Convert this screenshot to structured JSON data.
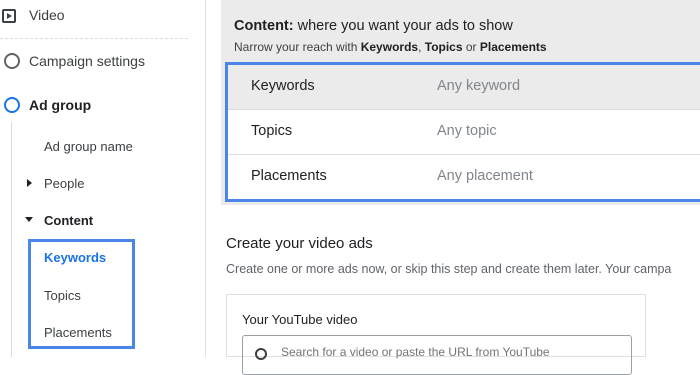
{
  "sidebar": {
    "top_item": "Video",
    "steps": [
      {
        "label": "Campaign settings"
      },
      {
        "label": "Ad group"
      }
    ],
    "ad_group_name": "Ad group name",
    "people": "People",
    "content": "Content",
    "content_items": [
      "Keywords",
      "Topics",
      "Placements"
    ]
  },
  "content_section": {
    "title_bold": "Content:",
    "title_rest": " where you want your ads to show",
    "subtitle_prefix": "Narrow your reach with ",
    "subtitle_keywords": "Keywords",
    "subtitle_sep1": ", ",
    "subtitle_topics": "Topics",
    "subtitle_sep2": " or ",
    "subtitle_placements": "Placements",
    "options": [
      {
        "name": "Keywords",
        "value": "Any keyword"
      },
      {
        "name": "Topics",
        "value": "Any topic"
      },
      {
        "name": "Placements",
        "value": "Any placement"
      }
    ]
  },
  "create_section": {
    "title": "Create your video ads",
    "subtitle": "Create one or more ads now, or skip this step and create them later. Your campa",
    "video_label": "Your YouTube video",
    "search_placeholder": "Search for a video or paste the URL from YouTube"
  },
  "colors": {
    "accent": "#1a73e8",
    "highlight_border": "#4a86e8"
  }
}
